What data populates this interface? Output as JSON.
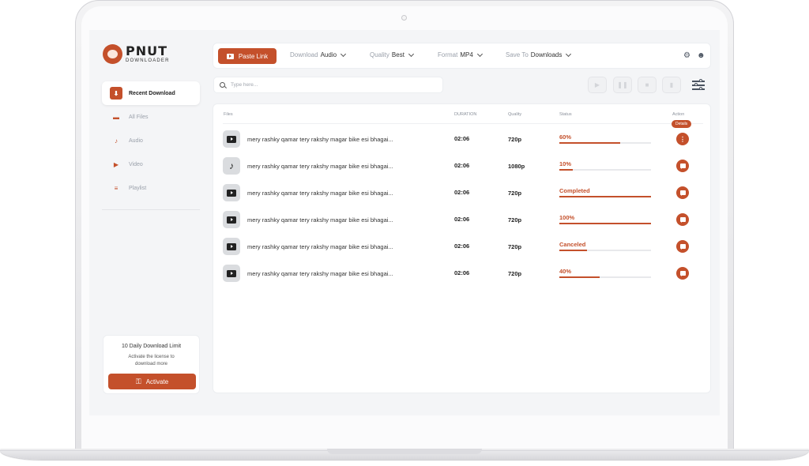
{
  "app": {
    "logo_title": "PNUT",
    "logo_subtitle": "DOWNLOADER"
  },
  "sidebar": {
    "items": [
      {
        "label": "Recent Download",
        "icon": "download-icon",
        "active": true
      },
      {
        "label": "All Files",
        "icon": "folder-icon",
        "active": false
      },
      {
        "label": "Audio",
        "icon": "music-note-icon",
        "active": false
      },
      {
        "label": "Video",
        "icon": "video-icon",
        "active": false
      },
      {
        "label": "Playlist",
        "icon": "playlist-icon",
        "active": false
      }
    ],
    "license": {
      "title": "10 Daily Download Limit",
      "description": "Activate the license to download more",
      "button_label": "Activate"
    }
  },
  "toolbar": {
    "paste_label": "Paste Link",
    "download": {
      "label": "Download",
      "value": "Audio"
    },
    "quality": {
      "label": "Quality",
      "value": "Best"
    },
    "format": {
      "label": "Format",
      "value": "MP4"
    },
    "save_to": {
      "label": "Save To",
      "value": "Downloads"
    }
  },
  "search": {
    "placeholder": "Type here..."
  },
  "table": {
    "headers": {
      "files": "Files",
      "duration": "DURATION",
      "quality": "Quality",
      "status": "Status",
      "action": "Action"
    },
    "tooltip": "Details",
    "rows": [
      {
        "type": "video",
        "name": "mery rashky qamar tery rakshy magar bike esi bhagai...",
        "duration": "02:06",
        "quality": "720p",
        "status": "60%",
        "progress": 0.66,
        "action": "more"
      },
      {
        "type": "audio",
        "name": "mery rashky qamar tery rakshy magar bike esi bhagai...",
        "duration": "02:06",
        "quality": "1080p",
        "status": "10%",
        "progress": 0.15,
        "action": "message"
      },
      {
        "type": "video",
        "name": "mery rashky qamar tery rakshy magar bike esi bhagai...",
        "duration": "02:06",
        "quality": "720p",
        "status": "Completed",
        "progress": 1.0,
        "action": "message"
      },
      {
        "type": "video",
        "name": "mery rashky qamar tery rakshy magar bike esi bhagai...",
        "duration": "02:06",
        "quality": "720p",
        "status": "100%",
        "progress": 1.0,
        "action": "message"
      },
      {
        "type": "video",
        "name": "mery rashky qamar tery rakshy magar bike esi bhagai...",
        "duration": "02:06",
        "quality": "720p",
        "status": "Canceled",
        "progress": 0.3,
        "action": "message"
      },
      {
        "type": "video",
        "name": "mery rashky qamar tery rakshy magar bike esi bhagai...",
        "duration": "02:06",
        "quality": "720p",
        "status": "40%",
        "progress": 0.44,
        "action": "message"
      }
    ]
  },
  "colors": {
    "accent": "#c4502b",
    "background": "#f4f5f7"
  }
}
